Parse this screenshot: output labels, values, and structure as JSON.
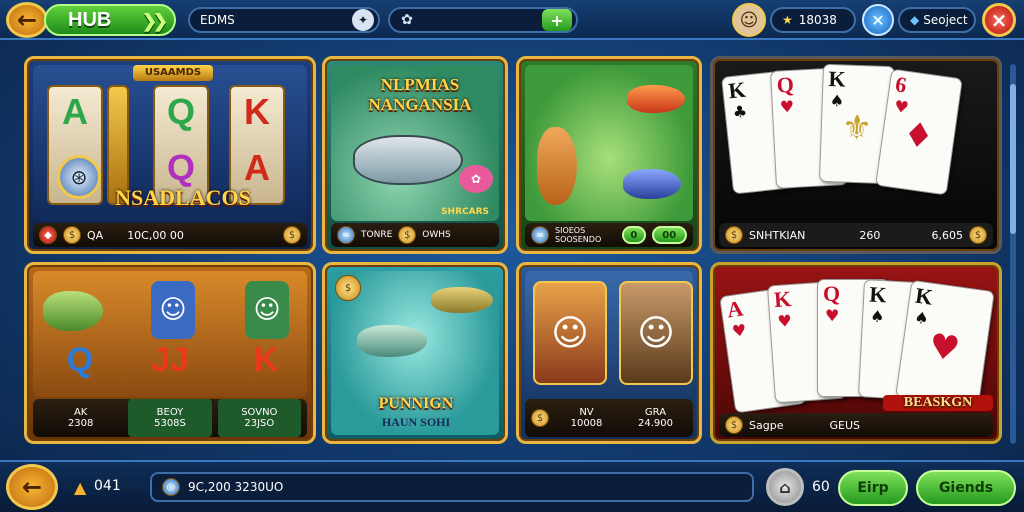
{
  "topbar": {
    "hub_label": "HUB",
    "search_value": "EDMS",
    "search_icon": "magnifier-icon",
    "field2_value": "",
    "add_label": "+",
    "balance_value": "18038",
    "currency_value": "Seoject",
    "close_label": "×"
  },
  "tiles": [
    {
      "title": "NSADLACOS",
      "banner": "USAAMDS",
      "footer_left": "QA",
      "footer_right": "10C,00 00",
      "symbols": [
        "A",
        "Q",
        "K",
        "Q",
        "A"
      ]
    },
    {
      "title": "NLPMIAS NANGANSIA",
      "footer_left": "TONRE",
      "footer_mid": "SHRCARS",
      "footer_right": "OWHS"
    },
    {
      "title": "",
      "footer_left": "SIOEOS SOOSENDO",
      "footer_right": "0",
      "footer_right2": "00"
    },
    {
      "title": "",
      "footer_left": "SNHTKIAN",
      "footer_mid": "260",
      "footer_right": "6,605",
      "cards": [
        "K",
        "Q",
        "K",
        "6"
      ]
    },
    {
      "title": "",
      "symbols": [
        "Q",
        "JJ",
        "K"
      ],
      "footer_col1_top": "AK",
      "footer_col1_bottom": "2308",
      "footer_col2_top": "BEOY",
      "footer_col2_bottom": "5308S",
      "footer_col3_top": "SOVNO",
      "footer_col3_bottom": "23JSO"
    },
    {
      "title": "PUNNIGN",
      "subtitle": "HAUN SOHI"
    },
    {
      "title": "",
      "footer_col1_top": "NV",
      "footer_col1_bottom": "10008",
      "footer_col2_top": "GRA",
      "footer_col2_bottom": "24.900"
    },
    {
      "title": "BEASKGN",
      "footer_left": "Sagpe",
      "footer_right": "GEUS",
      "cards": [
        "A",
        "K",
        "Q",
        "K",
        "K"
      ]
    }
  ],
  "bottombar": {
    "back_label": "←",
    "gold_value": "041",
    "message": "9C,200 3230UO",
    "lock_value": "60",
    "button1": "Eirp",
    "button2": "Giends"
  },
  "colors": {
    "accent": "#f2c94c",
    "primary": "#1e5a9e",
    "green": "#3fb82c",
    "red": "#c41b1b"
  }
}
